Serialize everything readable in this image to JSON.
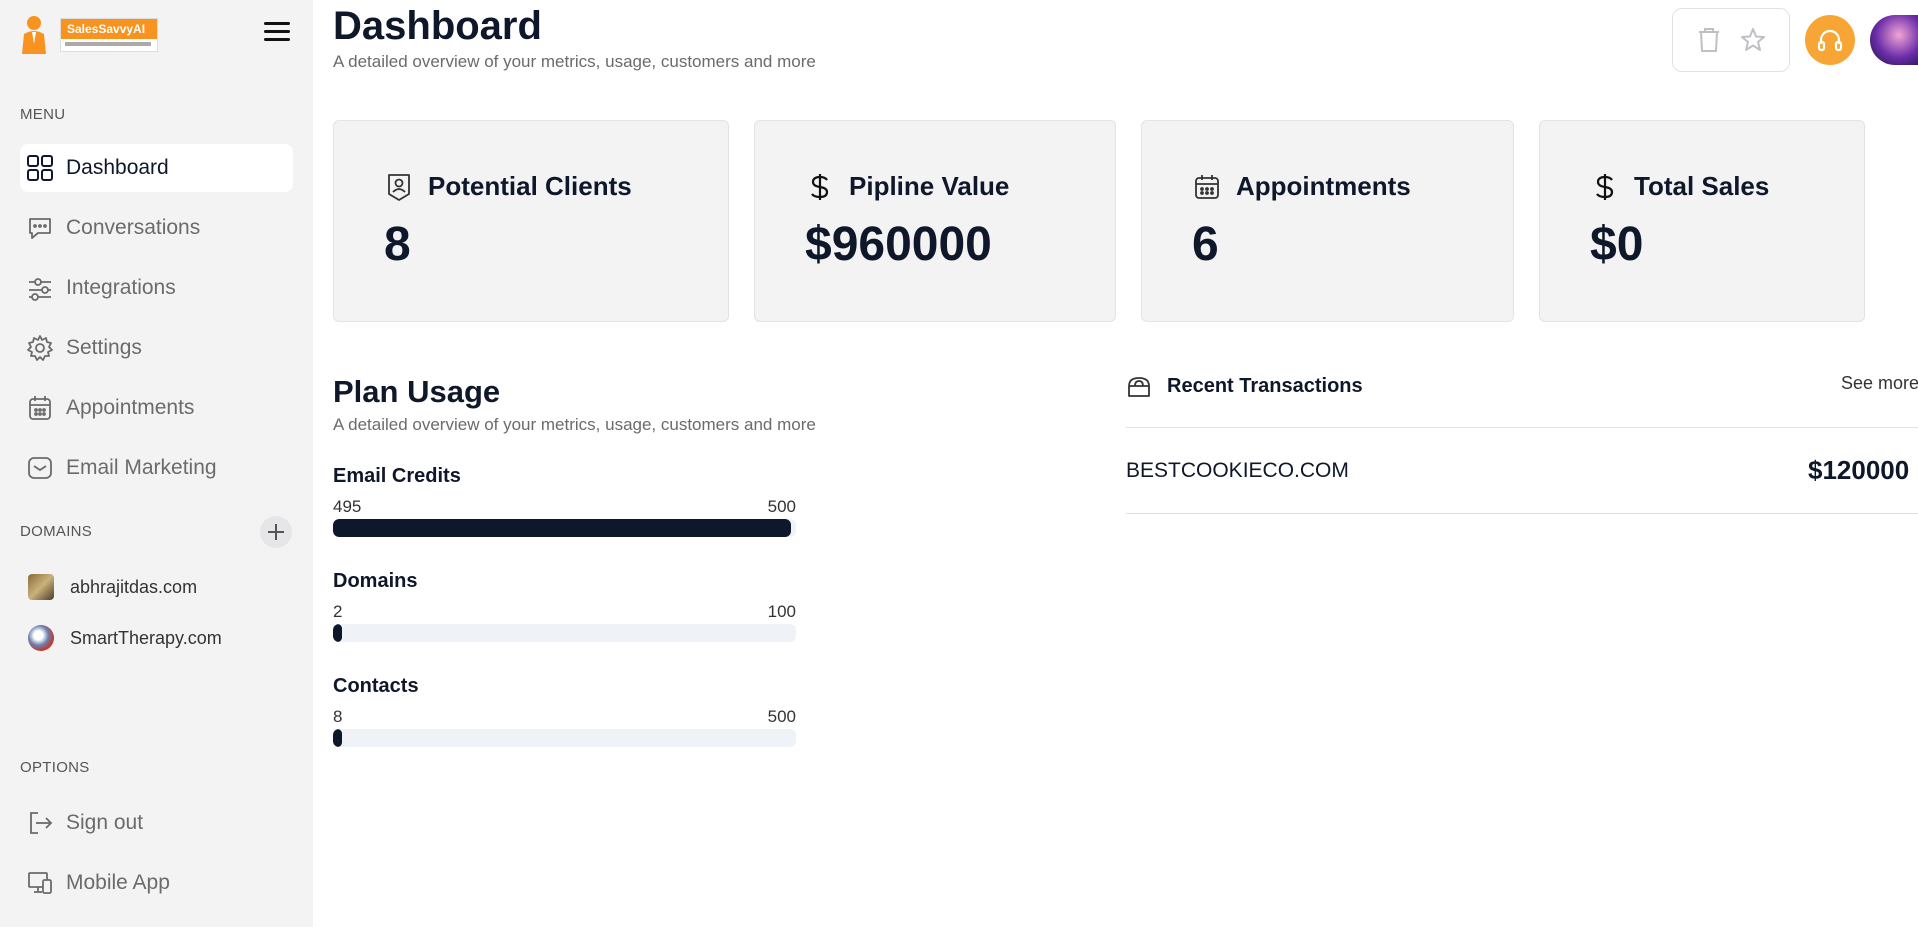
{
  "brand": {
    "name": "SalesSavvyAI"
  },
  "sidebar": {
    "menu_label": "MENU",
    "menu": [
      {
        "label": "Dashboard",
        "icon": "grid-icon"
      },
      {
        "label": "Conversations",
        "icon": "chat-icon"
      },
      {
        "label": "Integrations",
        "icon": "sliders-icon"
      },
      {
        "label": "Settings",
        "icon": "gear-icon"
      },
      {
        "label": "Appointments",
        "icon": "calendar-icon"
      },
      {
        "label": "Email Marketing",
        "icon": "mail-icon"
      }
    ],
    "domains_label": "DOMAINS",
    "domains": [
      {
        "label": "abhrajitdas.com"
      },
      {
        "label": "SmartTherapy.com"
      }
    ],
    "options_label": "OPTIONS",
    "options": [
      {
        "label": "Sign out",
        "icon": "sign-out-icon"
      },
      {
        "label": "Mobile App",
        "icon": "devices-icon"
      }
    ]
  },
  "header": {
    "title": "Dashboard",
    "subtitle": "A detailed overview of your metrics, usage, customers and more"
  },
  "cards": [
    {
      "label": "Potential Clients",
      "value": "8",
      "icon": "user-badge-icon"
    },
    {
      "label": "Pipline Value",
      "value": "$960000",
      "icon": "dollar-icon"
    },
    {
      "label": "Appointments",
      "value": "6",
      "icon": "calendar-icon"
    },
    {
      "label": "Total Sales",
      "value": "$0",
      "icon": "dollar-icon"
    }
  ],
  "plan": {
    "title": "Plan Usage",
    "subtitle": "A detailed overview of your metrics, usage, customers and more",
    "items": [
      {
        "name": "Email Credits",
        "used": "495",
        "total": "500",
        "fraction": 0.99
      },
      {
        "name": "Domains",
        "used": "2",
        "total": "100",
        "fraction": 0.02
      },
      {
        "name": "Contacts",
        "used": "8",
        "total": "500",
        "fraction": 0.016
      }
    ]
  },
  "transactions": {
    "title": "Recent Transactions",
    "see_more": "See more",
    "rows": [
      {
        "name": "BESTCOOKIECO.COM",
        "amount": "$120000"
      }
    ]
  },
  "colors": {
    "accent": "#f7a534",
    "dark": "#0f172a",
    "sidebar_bg": "#f3f3f4"
  }
}
